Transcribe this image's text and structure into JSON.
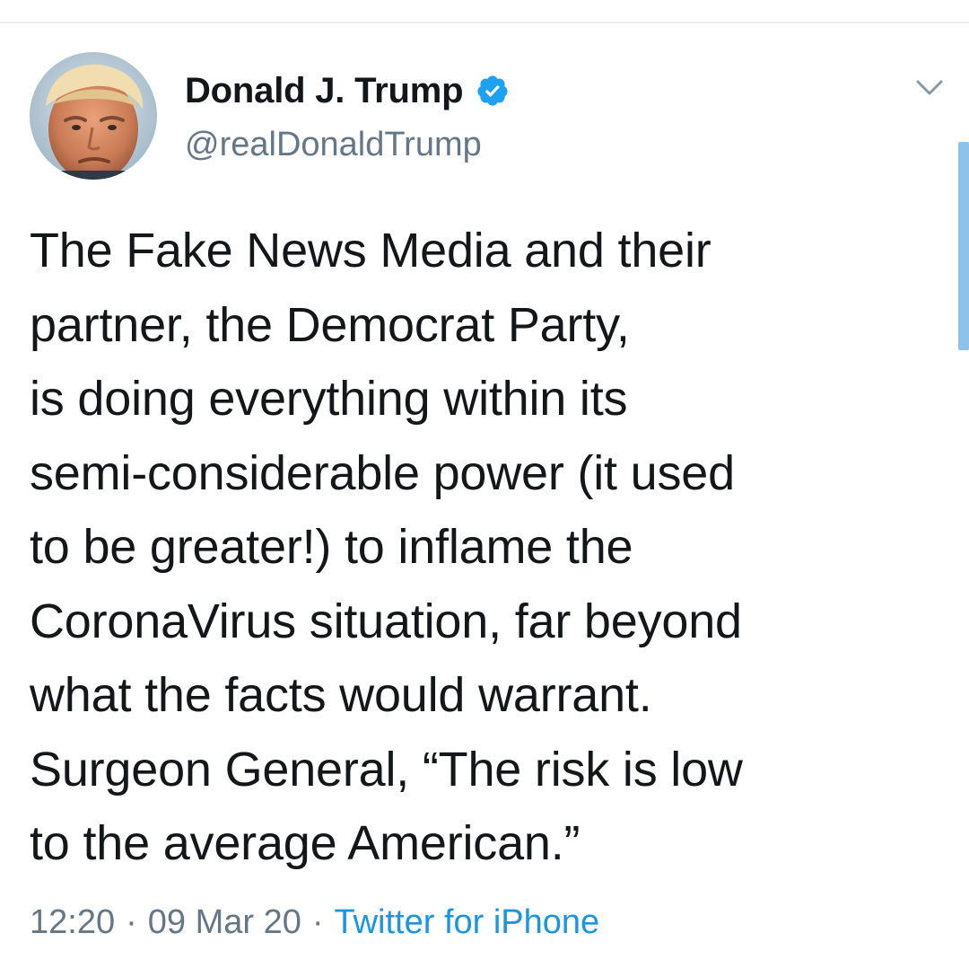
{
  "tweet": {
    "author": {
      "name": "Donald J. Trump",
      "handle": "@realDonaldTrump",
      "verified": true,
      "avatar_icon": "user-avatar"
    },
    "text": "The Fake News Media and their\npartner, the Democrat Party,\nis doing everything within its\nsemi-considerable power (it used\nto be greater!) to inflame the\nCoronaVirus situation, far beyond\nwhat the facts would warrant.\nSurgeon General, “The risk is low\nto the average American.”",
    "time": "12:20",
    "date": "09 Mar 20",
    "separator": "·",
    "source": "Twitter for iPhone"
  },
  "icons": {
    "verified": "verified-badge-icon",
    "menu": "chevron-down-icon"
  },
  "colors": {
    "verified_blue": "#1da1f2",
    "link_blue": "#1b95e0",
    "secondary_text": "#657786",
    "primary_text": "#14171a",
    "divider": "#e6ecf0",
    "scrollbar": "#8ec2ea"
  }
}
